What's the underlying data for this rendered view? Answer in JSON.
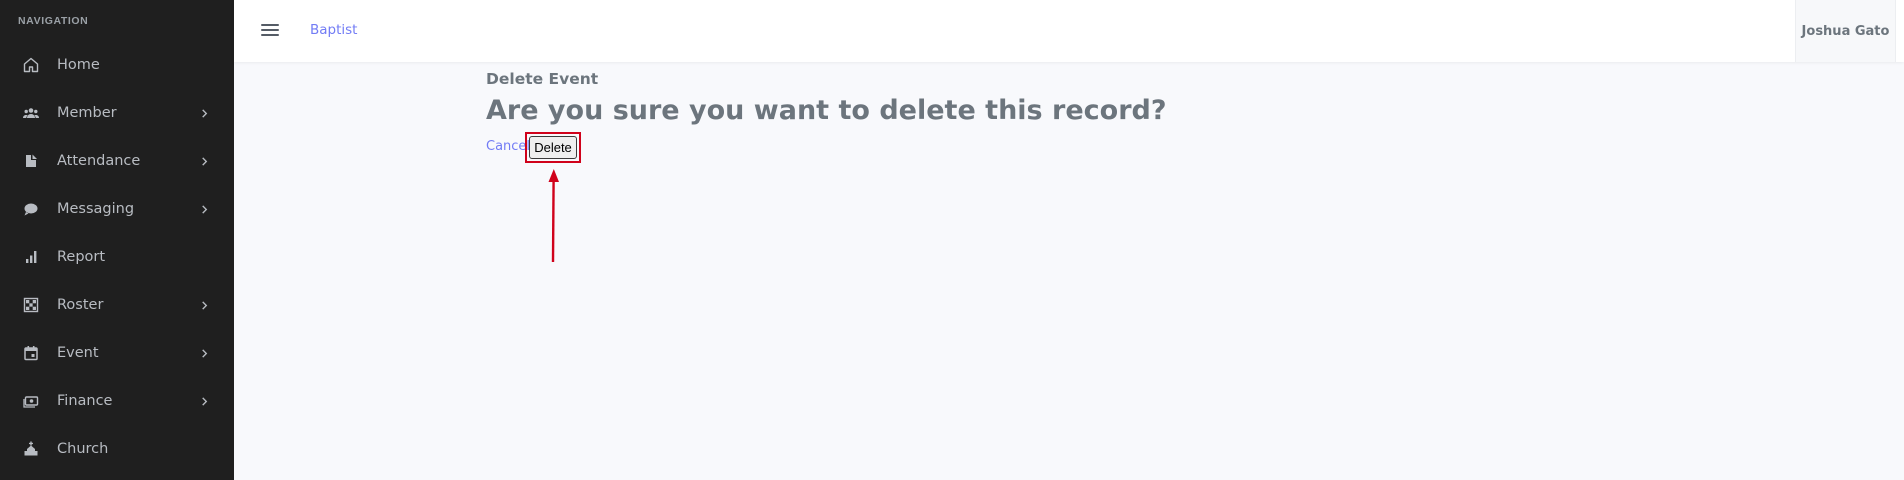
{
  "sidebar": {
    "heading": "NAVIGATION",
    "items": [
      {
        "label": "Home",
        "icon": "home-icon",
        "has_submenu": false
      },
      {
        "label": "Member",
        "icon": "users-icon",
        "has_submenu": true
      },
      {
        "label": "Attendance",
        "icon": "attendance-icon",
        "has_submenu": true
      },
      {
        "label": "Messaging",
        "icon": "chat-icon",
        "has_submenu": true
      },
      {
        "label": "Report",
        "icon": "bar-chart-icon",
        "has_submenu": false
      },
      {
        "label": "Roster",
        "icon": "roster-grid-icon",
        "has_submenu": true
      },
      {
        "label": "Event",
        "icon": "calendar-icon",
        "has_submenu": true
      },
      {
        "label": "Finance",
        "icon": "money-icon",
        "has_submenu": true
      },
      {
        "label": "Church",
        "icon": "church-icon",
        "has_submenu": false
      }
    ]
  },
  "header": {
    "brand": "Baptist",
    "user_name": "Joshua Gato"
  },
  "main": {
    "subtitle": "Delete Event",
    "question": "Are you sure you want to delete this record?",
    "cancel_label": "Cancel",
    "delete_label": "Delete"
  },
  "colors": {
    "sidebar_bg": "#1f1f1f",
    "accent": "#727cf5",
    "highlight": "#d0021b",
    "text_muted": "#6c757d"
  }
}
